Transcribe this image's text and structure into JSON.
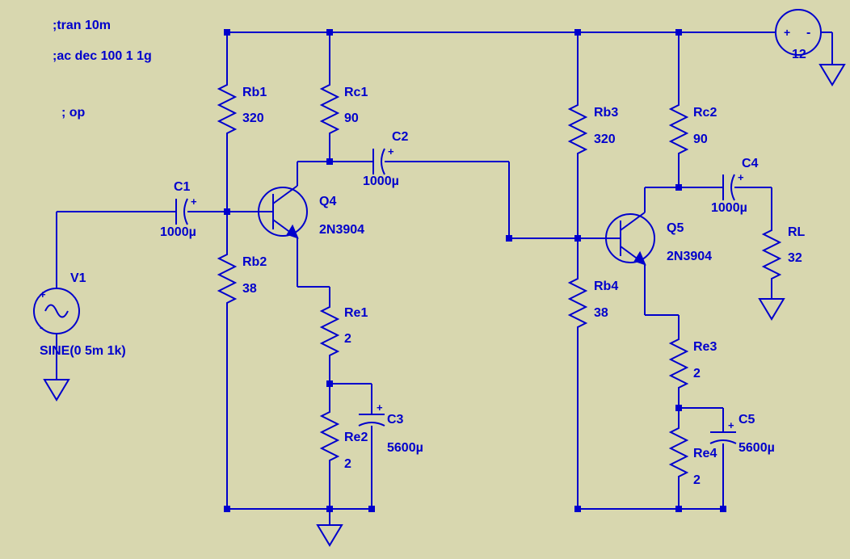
{
  "directives": {
    "tran": ";tran 10m",
    "ac": ";ac dec 100 1 1g",
    "op": "; op"
  },
  "source": {
    "name": "V1",
    "value": "SINE(0 5m 1k)"
  },
  "stage1": {
    "Rb1": {
      "name": "Rb1",
      "value": "320"
    },
    "Rc1": {
      "name": "Rc1",
      "value": "90"
    },
    "Rb2": {
      "name": "Rb2",
      "value": "38"
    },
    "Re1": {
      "name": "Re1",
      "value": "2"
    },
    "Re2": {
      "name": "Re2",
      "value": "2"
    },
    "C1": {
      "name": "C1",
      "value": "1000µ"
    },
    "C2": {
      "name": "C2",
      "value": "1000µ"
    },
    "C3": {
      "name": "C3",
      "value": "5600µ"
    },
    "Q4": {
      "name": "Q4",
      "model": "2N3904"
    }
  },
  "stage2": {
    "Rb3": {
      "name": "Rb3",
      "value": "320"
    },
    "Rc2": {
      "name": "Rc2",
      "value": "90"
    },
    "Rb4": {
      "name": "Rb4",
      "value": "38"
    },
    "Re3": {
      "name": "Re3",
      "value": "2"
    },
    "Re4": {
      "name": "Re4",
      "value": "2"
    },
    "C4": {
      "name": "C4",
      "value": "1000µ"
    },
    "C5": {
      "name": "C5",
      "value": "5600µ"
    },
    "Q5": {
      "name": "Q5",
      "model": "2N3904"
    }
  },
  "load": {
    "RL": {
      "name": "RL",
      "value": "32"
    }
  },
  "supply": {
    "value": "12"
  }
}
